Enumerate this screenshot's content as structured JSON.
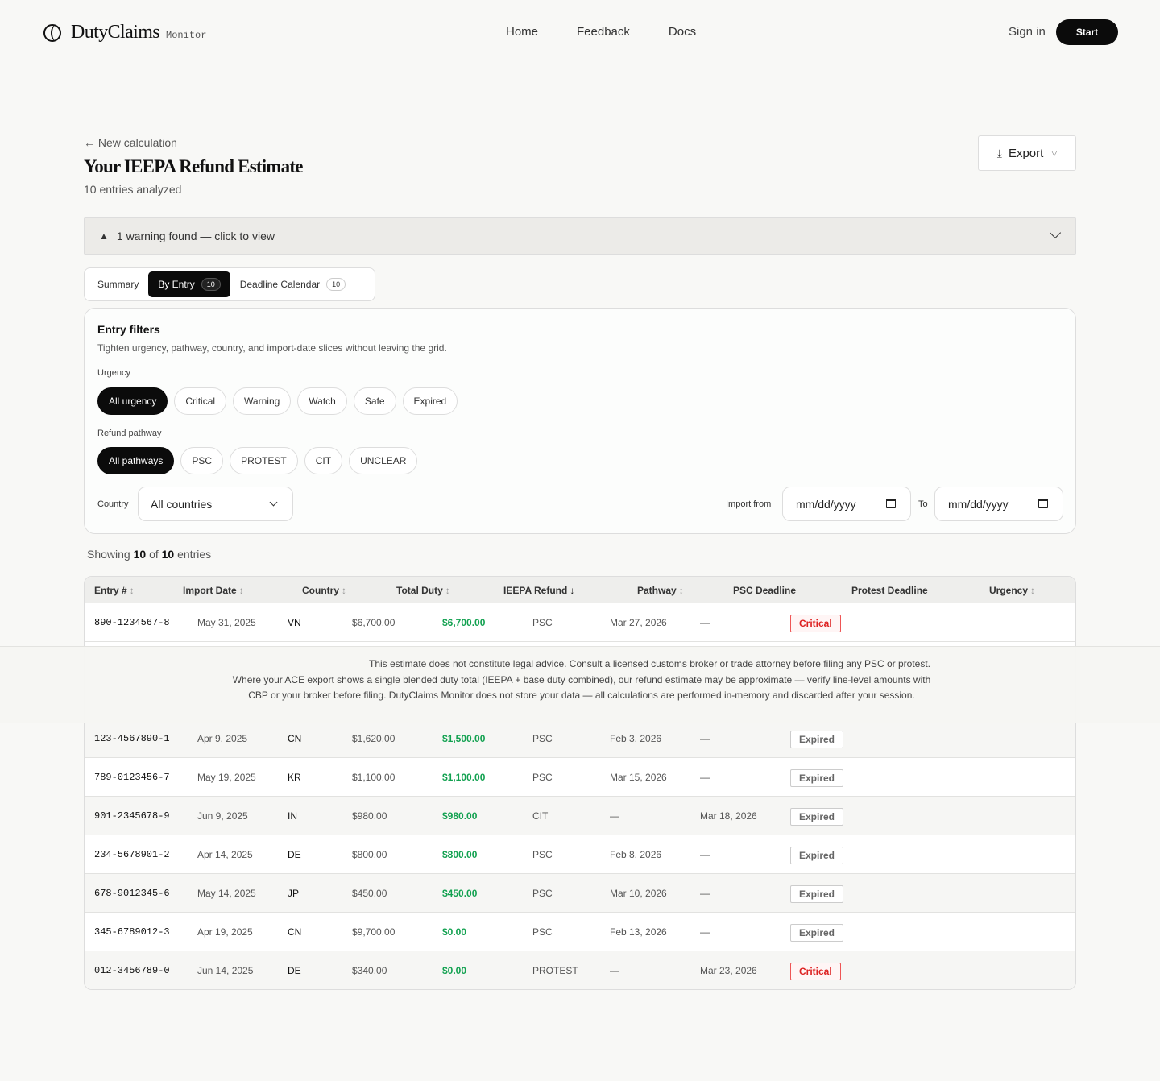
{
  "brand": {
    "name": "DutyClaims",
    "sub": "Monitor"
  },
  "nav": [
    "Home",
    "Feedback",
    "Docs"
  ],
  "auth": {
    "signin": "Sign in",
    "start": "Start"
  },
  "page": {
    "back": "← New calculation",
    "title": "Your IEEPA Refund Estimate",
    "subtitle": "10 entries analyzed",
    "export": "Export"
  },
  "warning": {
    "text": "1 warning found — click to view"
  },
  "tabs": [
    {
      "label": "Summary",
      "count": ""
    },
    {
      "label": "By Entry",
      "count": "10"
    },
    {
      "label": "Deadline Calendar",
      "count": "10"
    }
  ],
  "filters": {
    "title": "Entry filters",
    "desc": "Tighten urgency, pathway, country, and import-date slices without leaving the grid.",
    "urgency_label": "Urgency",
    "urgency": [
      "All urgency",
      "Critical",
      "Warning",
      "Watch",
      "Safe",
      "Expired"
    ],
    "pathway_label": "Refund pathway",
    "pathway": [
      "All pathways",
      "PSC",
      "PROTEST",
      "CIT",
      "UNCLEAR"
    ],
    "country_label": "Country",
    "country_value": "All countries",
    "import_from_label": "Import from",
    "to_label": "To",
    "date_placeholder": "mm/dd/yyyy"
  },
  "showing": {
    "prefix": "Showing",
    "shown": "10",
    "of": "of",
    "total": "10",
    "suffix": "entries"
  },
  "table": {
    "headers": [
      "Entry #",
      "Import Date",
      "Country",
      "Total Duty",
      "IEEPA Refund",
      "Pathway",
      "PSC Deadline",
      "Protest Deadline",
      "Urgency"
    ],
    "rows": [
      {
        "entry": "890-1234567-8",
        "date": "May 31, 2025",
        "country": "VN",
        "duty": "$6,700.00",
        "refund": "$6,700.00",
        "pathway": "PSC",
        "psc": "Mar 27, 2026",
        "protest": "—",
        "urgency": "Critical"
      },
      {
        "entry": "123-4567890-1",
        "date": "Apr 9, 2025",
        "country": "CN",
        "duty": "$1,620.00",
        "refund": "$1,500.00",
        "pathway": "PSC",
        "psc": "Feb 3, 2026",
        "protest": "—",
        "urgency": "Expired"
      },
      {
        "entry": "789-0123456-7",
        "date": "May 19, 2025",
        "country": "KR",
        "duty": "$1,100.00",
        "refund": "$1,100.00",
        "pathway": "PSC",
        "psc": "Mar 15, 2026",
        "protest": "—",
        "urgency": "Expired"
      },
      {
        "entry": "901-2345678-9",
        "date": "Jun 9, 2025",
        "country": "IN",
        "duty": "$980.00",
        "refund": "$980.00",
        "pathway": "CIT",
        "psc": "—",
        "protest": "Mar 18, 2026",
        "urgency": "Expired"
      },
      {
        "entry": "234-5678901-2",
        "date": "Apr 14, 2025",
        "country": "DE",
        "duty": "$800.00",
        "refund": "$800.00",
        "pathway": "PSC",
        "psc": "Feb 8, 2026",
        "protest": "—",
        "urgency": "Expired"
      },
      {
        "entry": "678-9012345-6",
        "date": "May 14, 2025",
        "country": "JP",
        "duty": "$450.00",
        "refund": "$450.00",
        "pathway": "PSC",
        "psc": "Mar 10, 2026",
        "protest": "—",
        "urgency": "Expired"
      },
      {
        "entry": "345-6789012-3",
        "date": "Apr 19, 2025",
        "country": "CN",
        "duty": "$9,700.00",
        "refund": "$0.00",
        "pathway": "PSC",
        "psc": "Feb 13, 2026",
        "protest": "—",
        "urgency": "Expired"
      },
      {
        "entry": "012-3456789-0",
        "date": "Jun 14, 2025",
        "country": "DE",
        "duty": "$340.00",
        "refund": "$0.00",
        "pathway": "PROTEST",
        "psc": "—",
        "protest": "Mar 23, 2026",
        "urgency": "Critical"
      }
    ]
  },
  "disclaimer": "This estimate does not constitute legal advice. Consult a licensed customs broker or trade attorney before filing any PSC or protest. Where your ACE export shows a single blended duty total (IEEPA + base duty combined), our refund estimate may be approximate — verify line-level amounts with CBP or your broker before filing. DutyClaims Monitor does not store your data — all calculations are performed in-memory and discarded after your session.",
  "colors": {
    "accent": "#0b0b0b",
    "refund": "#12a150",
    "critical": "#d22222",
    "expired": "#666666"
  }
}
